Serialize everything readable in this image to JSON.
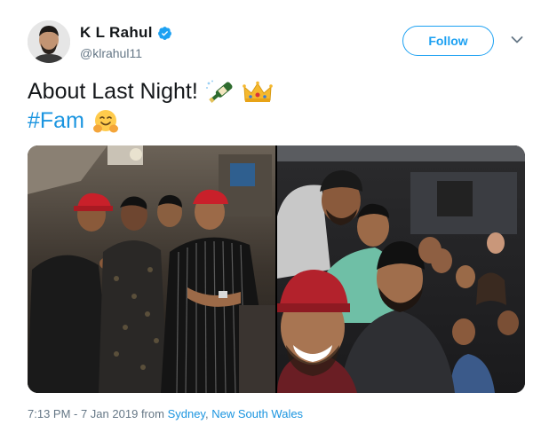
{
  "author": {
    "name": "K L Rahul",
    "handle": "@klrahul11",
    "verified": true
  },
  "actions": {
    "follow_label": "Follow",
    "menu_icon": "chevron-down-icon"
  },
  "tweet": {
    "line1_text": "About Last Night!",
    "line1_emojis": [
      "champagne-bottle-emoji",
      "crown-emoji"
    ],
    "hashtag": "#Fam",
    "hashtag_emoji": "hugging-face-emoji"
  },
  "media": {
    "photos": [
      "group-photo-left",
      "group-selfie-right"
    ]
  },
  "timestamp": {
    "time_date": "7:13 PM - 7 Jan 2019",
    "from_label": "from",
    "location_city": "Sydney",
    "separator": ",",
    "location_region": "New South Wales"
  },
  "colors": {
    "accent": "#1da1f2",
    "link": "#1b95e0",
    "text": "#14171a",
    "muted": "#657786"
  }
}
